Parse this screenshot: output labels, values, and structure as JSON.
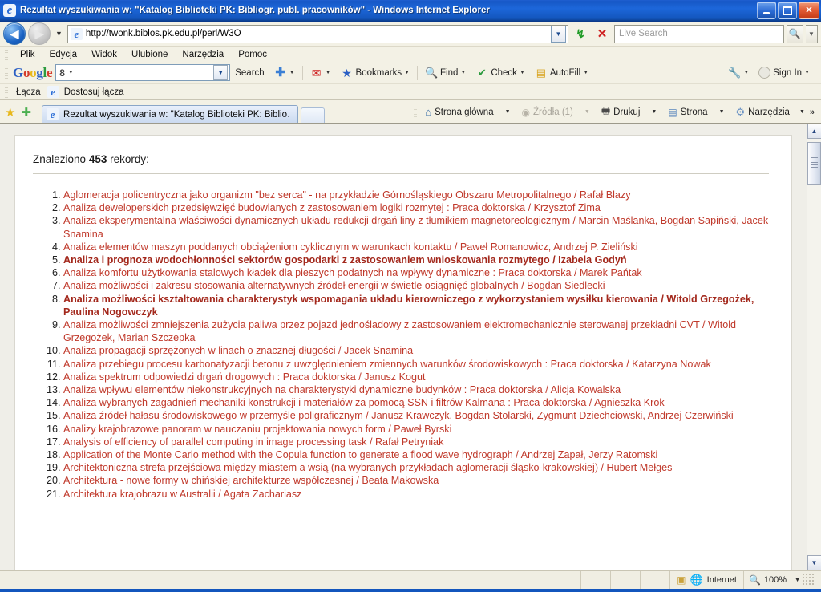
{
  "window": {
    "title": "Rezultat wyszukiwania w: \"Katalog Biblioteki PK: Bibliogr. publ. pracowników\" - Windows Internet Explorer",
    "minimize_label": "Minimize",
    "restore_label": "Restore",
    "close_label": "Close"
  },
  "navbar": {
    "back_label": "Back",
    "forward_label": "Forward",
    "history_caret": "▼",
    "url": "http://twonk.biblos.pk.edu.pl/perl/W3O",
    "address_caret": "▼",
    "refresh_label": "Refresh",
    "stop_label": "Stop",
    "search_placeholder": "Live Search",
    "search_go_label": "Search",
    "search_caret": "▼"
  },
  "menu": {
    "items": [
      {
        "label": "Plik"
      },
      {
        "label": "Edycja"
      },
      {
        "label": "Widok"
      },
      {
        "label": "Ulubione"
      },
      {
        "label": "Narzędzia"
      },
      {
        "label": "Pomoc"
      }
    ]
  },
  "google_toolbar": {
    "logo": {
      "g1": "G",
      "o1": "o",
      "o2": "o",
      "g2": "g",
      "l": "l",
      "e": "e"
    },
    "search_value": "",
    "engine_badge": "8",
    "items": [
      {
        "label": "Search",
        "icon": ""
      },
      {
        "label": "",
        "icon": "plus-icon"
      },
      {
        "label": "",
        "icon": "gmail-icon"
      },
      {
        "label": "Bookmarks",
        "icon": "star-icon"
      },
      {
        "label": "Find",
        "icon": "find-icon"
      },
      {
        "label": "Check",
        "icon": "check-icon"
      },
      {
        "label": "AutoFill",
        "icon": "autofill-icon"
      }
    ],
    "settings_label": "",
    "sign_in_label": "Sign In"
  },
  "links_bar": {
    "label": "Łącza",
    "item": "Dostosuj łącza"
  },
  "tabs": {
    "favorites_label": "Favorites",
    "add_favorite_label": "Add to Favorites",
    "active_tab": "Rezultat wyszukiwania w: \"Katalog Biblioteki PK: Biblio…",
    "new_tab_label": "New Tab"
  },
  "command_bar": {
    "items": [
      {
        "label": "Strona główna",
        "icon": "home-icon",
        "disabled": false,
        "caret": "▼"
      },
      {
        "label": "Źródła (1)",
        "icon": "rss-icon",
        "disabled": true,
        "caret": "▼"
      },
      {
        "label": "Drukuj",
        "icon": "print-icon",
        "disabled": false,
        "caret": "▼"
      },
      {
        "label": "Strona",
        "icon": "page-icon",
        "disabled": false,
        "caret": "▼"
      },
      {
        "label": "Narzędzia",
        "icon": "tools-icon",
        "disabled": false,
        "caret": "▼"
      }
    ],
    "overflow": "»"
  },
  "content": {
    "found_prefix": "Znaleziono",
    "found_count": "453",
    "found_suffix": "rekordy:",
    "results": [
      {
        "text": "Aglomeracja policentryczna jako organizm \"bez serca\" - na przykładzie Górnośląskiego Obszaru Metropolitalnego / Rafał Blazy",
        "bold": false
      },
      {
        "text": "Analiza deweloperskich przedsięwzięć budowlanych z zastosowaniem logiki rozmytej : Praca doktorska / Krzysztof Zima",
        "bold": false
      },
      {
        "text": "Analiza eksperymentalna właściwości dynamicznych układu redukcji drgań liny z tłumikiem magnetoreologicznym / Marcin Maślanka, Bogdan Sapiński, Jacek Snamina",
        "bold": false
      },
      {
        "text": "Analiza elementów maszyn poddanych obciążeniom cyklicznym w warunkach kontaktu / Paweł Romanowicz, Andrzej P. Zieliński",
        "bold": false
      },
      {
        "text": "Analiza i prognoza wodochłonności sektorów gospodarki z zastosowaniem wnioskowania rozmytego / Izabela Godyń",
        "bold": true
      },
      {
        "text": "Analiza komfortu użytkowania stalowych kładek dla pieszych podatnych na wpływy dynamiczne : Praca doktorska / Marek Pańtak",
        "bold": false
      },
      {
        "text": "Analiza możliwości i zakresu stosowania alternatywnych źródeł energii w świetle osiągnięć globalnych / Bogdan Siedlecki",
        "bold": false
      },
      {
        "text": "Analiza możliwości kształtowania charakterystyk wspomagania układu kierowniczego z wykorzystaniem wysiłku kierowania / Witold Grzegożek, Paulina Nogowczyk",
        "bold": true
      },
      {
        "text": "Analiza możliwości zmniejszenia zużycia paliwa przez pojazd jednośladowy z zastosowaniem elektromechanicznie sterowanej przekładni CVT / Witold Grzegożek, Marian Szczepka",
        "bold": false
      },
      {
        "text": "Analiza propagacji sprzężonych w linach o znacznej długości / Jacek Snamina",
        "bold": false
      },
      {
        "text": "Analiza przebiegu procesu karbonatyzacji betonu z uwzględnieniem zmiennych warunków środowiskowych : Praca doktorska / Katarzyna Nowak",
        "bold": false
      },
      {
        "text": "Analiza spektrum odpowiedzi drgań drogowych : Praca doktorska / Janusz Kogut",
        "bold": false
      },
      {
        "text": "Analiza wpływu elementów niekonstrukcyjnych na charakterystyki dynamiczne budynków : Praca doktorska / Alicja Kowalska",
        "bold": false
      },
      {
        "text": "Analiza wybranych zagadnień mechaniki konstrukcji i materiałów za pomocą SSN i filtrów Kalmana : Praca doktorska / Agnieszka Krok",
        "bold": false
      },
      {
        "text": "Analiza źródeł hałasu środowiskowego w przemyśle poligraficznym / Janusz Krawczyk, Bogdan Stolarski, Zygmunt Dziechciowski, Andrzej Czerwiński",
        "bold": false
      },
      {
        "text": "Analizy krajobrazowe panoram w nauczaniu projektowania nowych form / Paweł Byrski",
        "bold": false
      },
      {
        "text": "Analysis of efficiency of parallel computing in image processing task / Rafał Petryniak",
        "bold": false
      },
      {
        "text": "Application of the Monte Carlo method with the Copula function to generate a flood wave hydrograph / Andrzej Zapał, Jerzy Ratomski",
        "bold": false
      },
      {
        "text": "Architektoniczna strefa przejściowa między miastem a wsią (na wybranych przykładach aglomeracji śląsko-krakowskiej) / Hubert Mełges",
        "bold": false
      },
      {
        "text": "Architektura - nowe formy w chińskiej architekturze współczesnej / Beata Makowska",
        "bold": false
      },
      {
        "text": "Architektura krajobrazu w Australii / Agata Zachariasz",
        "bold": false
      }
    ]
  },
  "scrollbar": {
    "up_label": "▲",
    "down_label": "▼"
  },
  "statusbar": {
    "message": "",
    "zone_label": "Internet",
    "zoom_label": "100%",
    "zoom_caret": "▼"
  },
  "colors": {
    "link": "#c0392b",
    "title_bar": "#1356bd",
    "toolbar_bg": "#f3f1e5",
    "page_bg": "#efeee8"
  }
}
